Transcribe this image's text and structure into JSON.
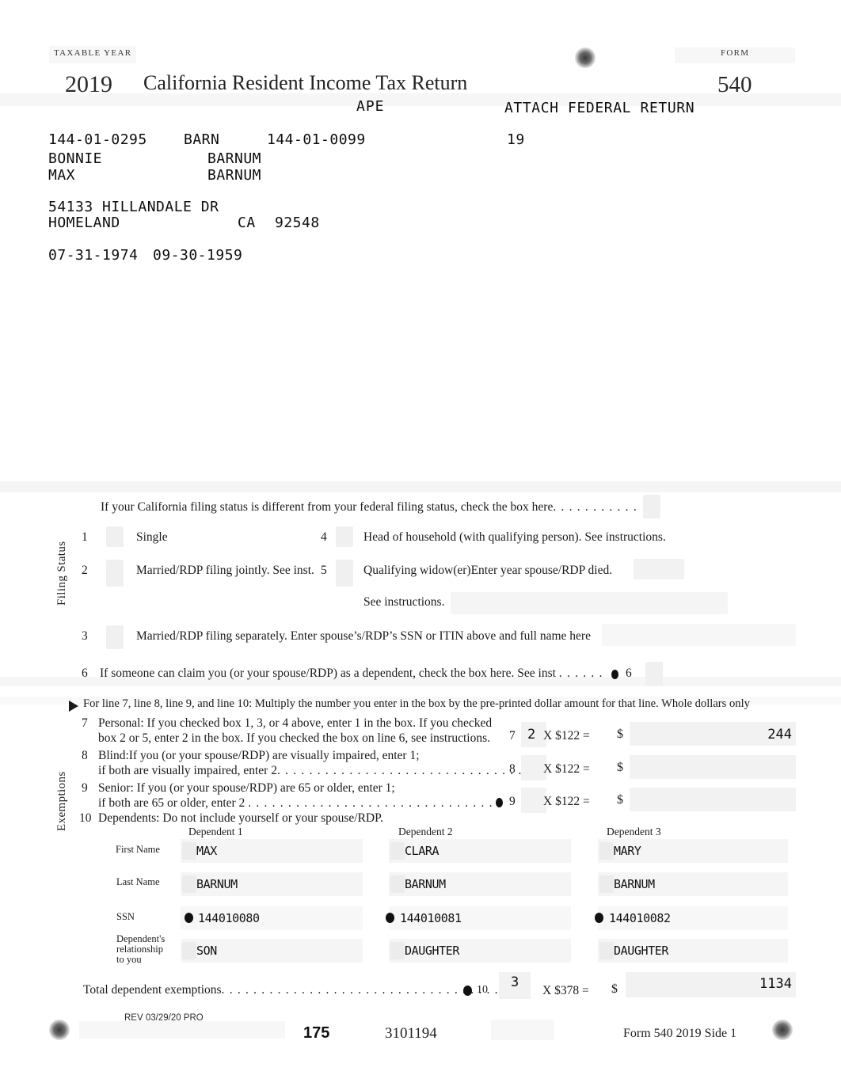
{
  "header": {
    "taxable_year_label": "TAXABLE YEAR",
    "year": "2019",
    "title": "California Resident Income Tax Return",
    "form_label": "FORM",
    "form_number": "540",
    "ape": "APE",
    "attach_note": "ATTACH FEDERAL RETURN",
    "attach_code": "19"
  },
  "taxpayer": {
    "ssn_primary": "144-01-0295",
    "name_code": "BARN",
    "ssn_spouse": "144-01-0099",
    "first_name_1": "BONNIE",
    "last_name_1": "BARNUM",
    "first_name_2": "MAX",
    "last_name_2": "BARNUM",
    "street": "54133 HILLANDALE DR",
    "city": "HOMELAND",
    "state": "CA",
    "zip": "92548",
    "dob_1": "07-31-1974",
    "dob_2": "09-30-1959"
  },
  "filing_status": {
    "section_label": "Filing Status",
    "diff_status_note": "If your California filing status is different from your federal filing status, check the box here",
    "dots": ". . . . . . . . . . .",
    "options": [
      {
        "num": "1",
        "label": "Single"
      },
      {
        "num": "2",
        "label": "Married/RDP filing jointly. See inst."
      },
      {
        "num": "3",
        "label": "Married/RDP filing separately. Enter spouse’s/RDP’s SSN or ITIN above and full name here"
      },
      {
        "num": "4",
        "label": "Head of household (with qualifying person). See instructions."
      },
      {
        "num": "5",
        "label": "Qualifying widow(er)Enter year spouse/RDP died."
      }
    ],
    "see_instructions": "See instructions.",
    "line6_num": "6",
    "line6_text": "If someone can claim you (or your spouse/RDP) as a dependent, check the box here. See inst",
    "line6_dots": ". . . . . .",
    "line6_ref": "6"
  },
  "exemptions": {
    "section_label": "Exemptions",
    "arrow_note": "For line 7, line 8, line 9, and line 10: Multiply the number you enter in the box by the pre-printed dollar amount for that line. Whole dollars only",
    "line7": {
      "num": "7",
      "text_l1": "Personal:  If you checked box 1, 3, or 4 above, enter 1 in the box. If you checked",
      "text_l2": "box 2 or 5, enter 2 in the box. If you checked the box on line 6, see instructions.",
      "ref": "7",
      "count": "2",
      "multiplier": "X $122 =",
      "dollar": "$",
      "amount": "244"
    },
    "line8": {
      "num": "8",
      "text_l1": "Blind:If you (or your spouse/RDP) are visually impaired, enter 1;",
      "text_l2": "if both are visually impaired, enter 2",
      "dots": ". . . . . . . . . . . . . . . . . . . . . . . . . . . . . . .",
      "ref": "8",
      "count": "",
      "multiplier": "X $122 =",
      "dollar": "$",
      "amount": ""
    },
    "line9": {
      "num": "9",
      "text_l1": "Senior: If you (or your spouse/RDP) are 65 or older, enter 1;",
      "text_l2": "if both are 65 or older, enter 2 ",
      "dots": ". . . . . . . . . . . . . . . . . . . . . . . . . . . . . . . .",
      "ref": "9",
      "count": "",
      "multiplier": "X $122 =",
      "dollar": "$",
      "amount": ""
    },
    "line10": {
      "num": "10",
      "text": "Dependents: Do not include yourself or your spouse/RDP."
    },
    "dependent_columns": [
      "Dependent 1",
      "Dependent 2",
      "Dependent 3"
    ],
    "row_labels": {
      "first_name": "First Name",
      "last_name": "Last Name",
      "ssn": "SSN",
      "relationship_l1": "Dependent's",
      "relationship_l2": "relationship",
      "relationship_l3": "to you"
    },
    "dependents": [
      {
        "first_name": "MAX",
        "last_name": "BARNUM",
        "ssn": "144010080",
        "relationship": "SON"
      },
      {
        "first_name": "CLARA",
        "last_name": "BARNUM",
        "ssn": "144010081",
        "relationship": "DAUGHTER"
      },
      {
        "first_name": "MARY",
        "last_name": "BARNUM",
        "ssn": "144010082",
        "relationship": "DAUGHTER"
      }
    ],
    "total": {
      "label": "Total dependent exemptions",
      "dots": ". . . . . . . . . . . . . . . . . . . . . . . . . . . . . . . . . . .",
      "ref": "10",
      "count": "3",
      "multiplier": "X $378 =",
      "dollar": "$",
      "amount": "1134"
    }
  },
  "footer": {
    "rev": "REV 03/29/20 PRO",
    "code_left": "175",
    "code_center": "3101194",
    "form_side": "Form 540 2019 Side 1"
  },
  "colors": {
    "field_fill": "#f2f2f2",
    "text": "#1a1a1a",
    "band": "#f4f4f4"
  }
}
